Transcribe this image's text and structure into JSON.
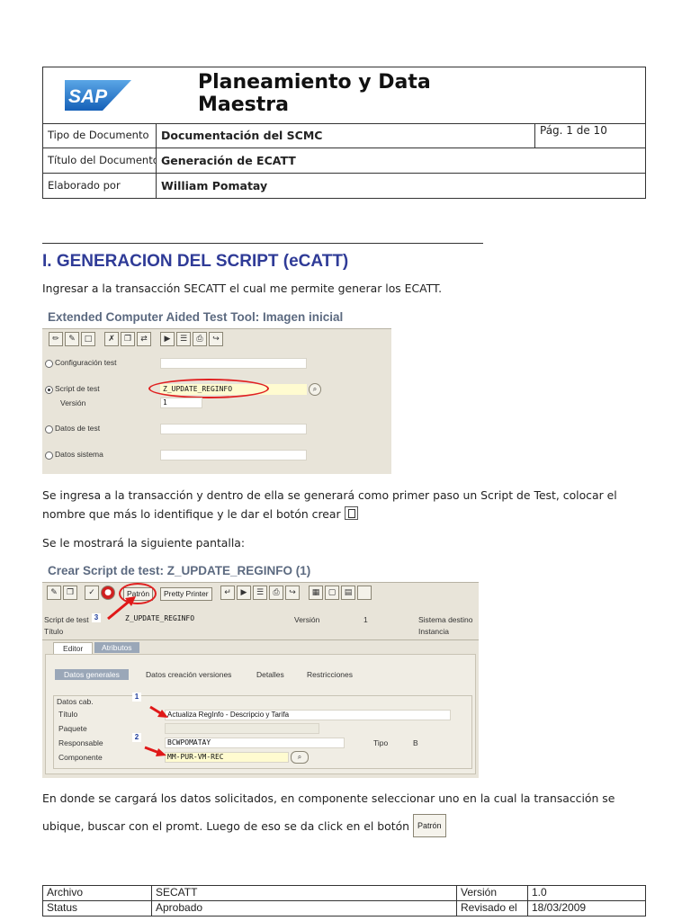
{
  "header": {
    "logo_text": "SAP",
    "title": "Planeamiento y Data Maestra",
    "rows": [
      {
        "label": "Tipo de Documento",
        "value": "Documentación del SCMC",
        "page": "Pág. 1 de 10"
      },
      {
        "label": "Título del Documento",
        "value": "Generación de ECATT"
      },
      {
        "label": "Elaborado por",
        "value": "William Pomatay"
      }
    ]
  },
  "section": {
    "heading": "I. GENERACION DEL SCRIPT (eCATT)",
    "p1": "Ingresar a la transacción SECATT el cual me permite generar los ECATT.",
    "p2a": "Se ingresa a la transacción y dentro de ella se generará como primer paso un Script de Test, colocar el",
    "p2b": "nombre que más lo identifique y le dar el botón crear",
    "p3": "Se le mostrará la siguiente pantalla:",
    "p4a": "En donde se cargará los datos solicitados, en componente seleccionar uno en la cual la transacción se",
    "p4b": "ubique, buscar con el promt. Luego de eso se da click en el botón",
    "patron_label": "Patrón"
  },
  "screen1": {
    "title": "Extended Computer Aided Test Tool: Imagen inicial",
    "options": [
      {
        "label": "Configuración test"
      },
      {
        "label": "Script de test",
        "value": "Z_UPDATE_REGINFO"
      },
      {
        "label": "Versión",
        "value": "1"
      },
      {
        "label": "Datos de test"
      },
      {
        "label": "Datos sistema"
      }
    ]
  },
  "screen2": {
    "title": "Crear Script de test: Z_UPDATE_REGINFO (1)",
    "patron_button": "Patrón",
    "pretty_printer_button": "Pretty Printer",
    "script_label": "Script de test",
    "script_value": "Z_UPDATE_REGINFO",
    "version_label": "Versión",
    "version_value": "1",
    "sistema_label": "Sistema destino",
    "titulo_label": "Título",
    "instancia_label": "Instancia",
    "tabs_main": [
      "Editor",
      "Atributos"
    ],
    "tabs_sub": [
      "Datos generales",
      "Datos creación versiones",
      "Detalles",
      "Restricciones"
    ],
    "group_label": "Datos cab.",
    "fields": [
      {
        "label": "Título",
        "value": "Actualiza RegInfo - Descripcio y Tarifa"
      },
      {
        "label": "Paquete",
        "value": ""
      },
      {
        "label": "Responsable",
        "value": "BCWPOMATAY"
      },
      {
        "label": "Componente",
        "value": "MM-PUR-VM-REC"
      }
    ],
    "tipo_label": "Tipo",
    "tipo_value": "B",
    "markers": [
      "1",
      "2",
      "3"
    ]
  },
  "footer": {
    "rows": [
      {
        "label": "Archivo",
        "value": "SECATT",
        "label2": "Versión",
        "value2": "1.0"
      },
      {
        "label": "Status",
        "value": "Aprobado",
        "label2": "Revisado el",
        "value2": "18/03/2009"
      }
    ]
  }
}
